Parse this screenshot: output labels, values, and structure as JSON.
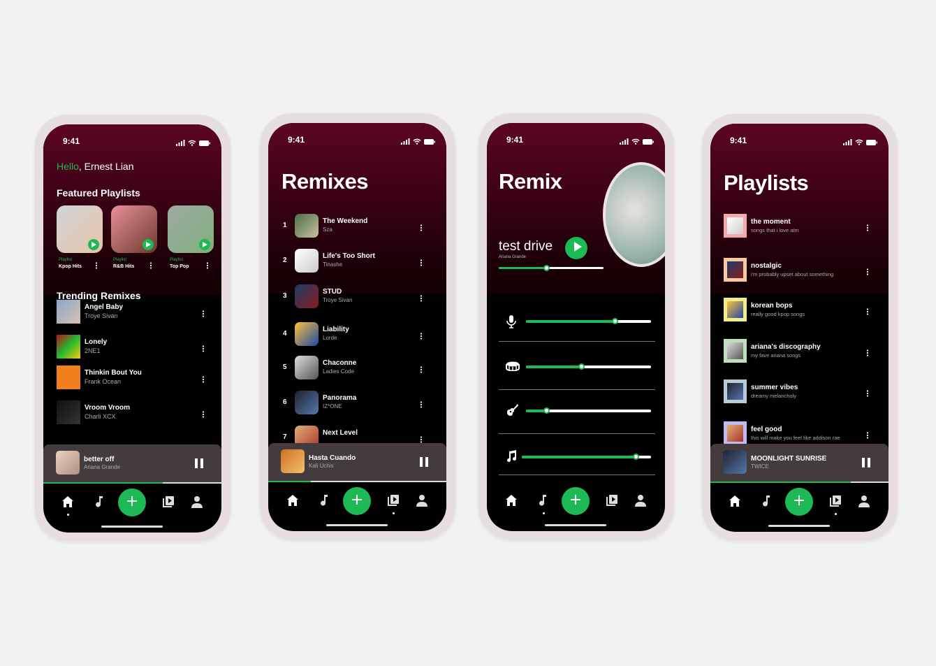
{
  "colors": {
    "accent": "#1db954",
    "maroon": "#5c0424",
    "player": "#433b3c"
  },
  "status_time": "9:41",
  "home": {
    "greeting_hello": "Hello",
    "greeting_name": ", Ernest Lian",
    "featured_title": "Featured Playlists",
    "featured": [
      {
        "type": "Playlist",
        "name": "Kpop Hits"
      },
      {
        "type": "Playlist",
        "name": "R&B Hits"
      },
      {
        "type": "Playlist",
        "name": "Top Pop"
      }
    ],
    "trending_title": "Trending Remixes",
    "trending": [
      {
        "title": "Angel Baby",
        "artist": "Troye Sivan"
      },
      {
        "title": "Lonely",
        "artist": "2NE1"
      },
      {
        "title": "Thinkin Bout You",
        "artist": "Frank Ocean"
      },
      {
        "title": "Vroom Vroom",
        "artist": "Charli XCX"
      }
    ],
    "now_playing": {
      "title": "better off",
      "artist": "Ariana Grande",
      "progress": 0.67
    },
    "active_tab": "home"
  },
  "remixes": {
    "title": "Remixes",
    "items": [
      {
        "rank": "1",
        "title": "The Weekend",
        "artist": "Sza"
      },
      {
        "rank": "2",
        "title": "Life's Too Short",
        "artist": "Tinashe"
      },
      {
        "rank": "3",
        "title": "STUD",
        "artist": "Troye Sivan"
      },
      {
        "rank": "4",
        "title": "Liability",
        "artist": "Lorde"
      },
      {
        "rank": "5",
        "title": "Chaconne",
        "artist": "Ladies Code"
      },
      {
        "rank": "6",
        "title": "Panorama",
        "artist": "IZ*ONE"
      },
      {
        "rank": "7",
        "title": "Next Level",
        "artist": ""
      }
    ],
    "now_playing": {
      "title": "Hasta Cuando",
      "artist": "Kali Uchis",
      "progress": 0.24
    },
    "active_tab": "playlists"
  },
  "remix": {
    "title": "Remix",
    "song": "test drive",
    "artist": "Ariana Grande",
    "song_progress": 0.45,
    "tracks": [
      {
        "icon": "microphone-icon",
        "level": 0.71
      },
      {
        "icon": "drum-icon",
        "level": 0.44
      },
      {
        "icon": "guitar-icon",
        "level": 0.16
      },
      {
        "icon": "music-note-icon",
        "level": 0.88
      }
    ],
    "active_tab": "music"
  },
  "playlists": {
    "title": "Playlists",
    "items": [
      {
        "name": "the moment",
        "desc": "songs that i love atm",
        "frame": "#f4a9ad"
      },
      {
        "name": "nostalgic",
        "desc": "i'm probably upset about something",
        "frame": "#f9c9a0"
      },
      {
        "name": "korean bops",
        "desc": "really good kpop songs",
        "frame": "#f3ec8a"
      },
      {
        "name": "ariana's discography",
        "desc": "my fave ariana songs",
        "frame": "#bfe0bd"
      },
      {
        "name": "summer vibes",
        "desc": "dreamy melancholy",
        "frame": "#b7ccd8"
      },
      {
        "name": "feel good",
        "desc": "this will make you feel like addison rae",
        "frame": "#c3bbf0"
      }
    ],
    "now_playing": {
      "title": "MOONLIGHT SUNRISE",
      "artist": "TWICE",
      "progress": 0.79
    },
    "active_tab": "playlists"
  }
}
